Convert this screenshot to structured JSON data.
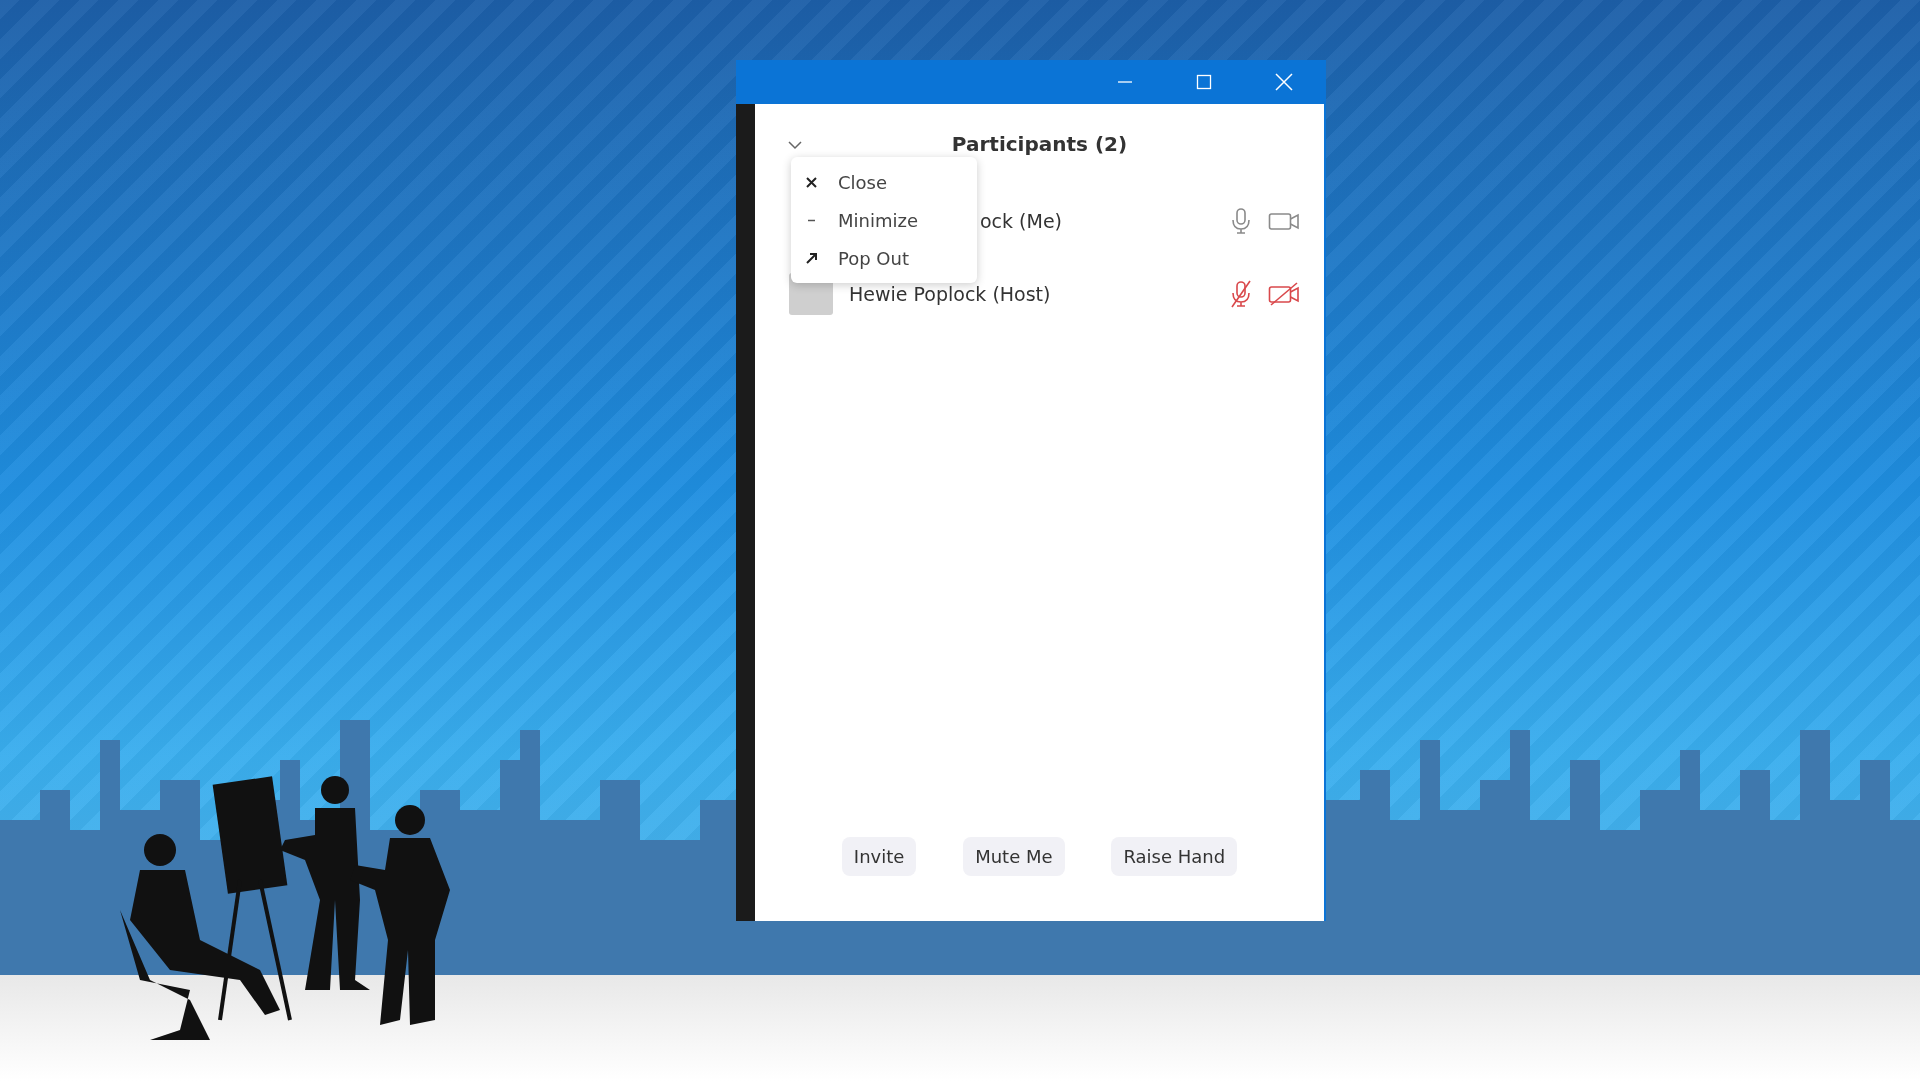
{
  "panel": {
    "title": "Participants (2)"
  },
  "menu": {
    "items": [
      {
        "kind": "close",
        "label": "Close"
      },
      {
        "kind": "minimize",
        "label": "Minimize"
      },
      {
        "kind": "popout",
        "label": "Pop Out"
      }
    ]
  },
  "participants": [
    {
      "name": "ock (Me)",
      "covered": true,
      "muted": false,
      "video_off": false
    },
    {
      "name": "Hewie Poplock (Host)",
      "covered": false,
      "muted": true,
      "video_off": true
    }
  ],
  "buttons": [
    "Invite",
    "Mute Me",
    "Raise Hand"
  ]
}
